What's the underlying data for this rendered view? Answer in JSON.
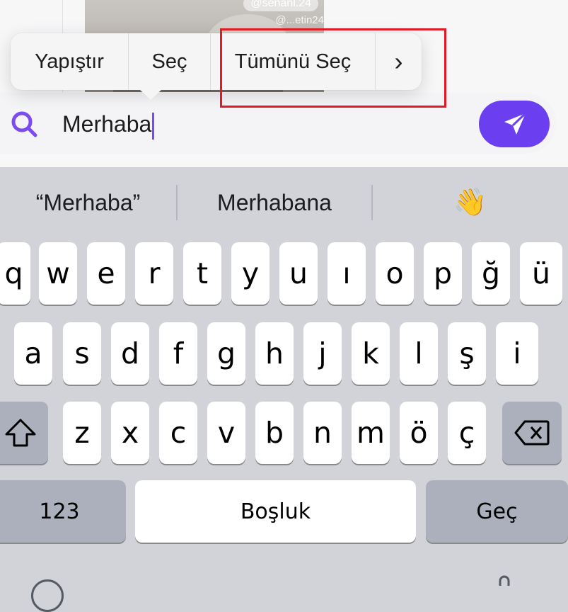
{
  "background": {
    "handle_top": "@senanl.24",
    "handle_bottom": "@...etin24"
  },
  "popover": {
    "items": [
      "Yapıştır",
      "Seç",
      "Tümünü Seç",
      "›"
    ]
  },
  "input": {
    "value": "Merhaba"
  },
  "suggestions": [
    "“Merhaba”",
    "Merhabana",
    "👋"
  ],
  "keyboard": {
    "row1": [
      "q",
      "w",
      "e",
      "r",
      "t",
      "y",
      "u",
      "ı",
      "o",
      "p",
      "ğ",
      "ü"
    ],
    "row2": [
      "a",
      "s",
      "d",
      "f",
      "g",
      "h",
      "j",
      "k",
      "l",
      "ş",
      "i"
    ],
    "row3": [
      "z",
      "x",
      "c",
      "v",
      "b",
      "n",
      "m",
      "ö",
      "ç"
    ],
    "numbers_label": "123",
    "space_label": "Boşluk",
    "return_label": "Geç"
  },
  "colors": {
    "accent": "#6b3ff0",
    "highlight": "#e01b24",
    "keyboard_bg": "#d1d3d9"
  }
}
